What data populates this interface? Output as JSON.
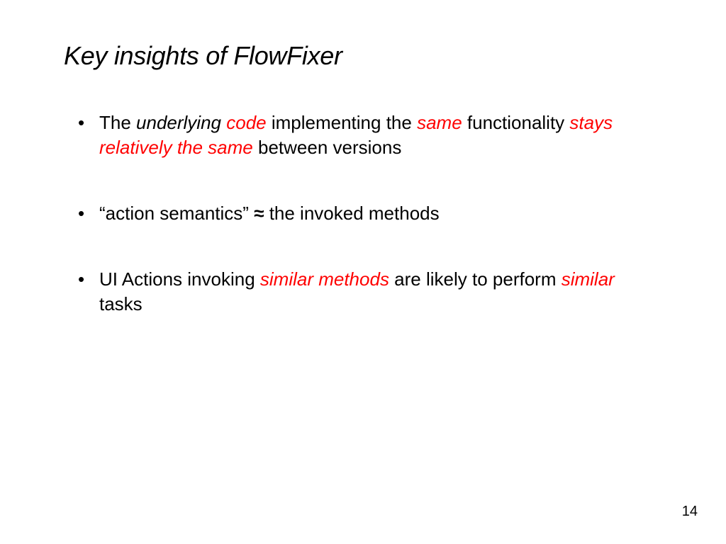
{
  "title": "Key insights of FlowFixer",
  "bullet1": {
    "t1": "The ",
    "t2": "underlying ",
    "t3": "code",
    "t4": " implementing the ",
    "t5": "same",
    "t6": " functionality ",
    "t7": "stays relatively the same",
    "t8": " between versions"
  },
  "bullet2": {
    "t1": "“action semantics”  ",
    "approx": "≈",
    "t2": "  the invoked methods"
  },
  "bullet3": {
    "t1": "UI Actions invoking ",
    "t2": "similar methods",
    "t3": " are likely to perform ",
    "t4": "similar",
    "t5": " tasks"
  },
  "page_number": "14"
}
